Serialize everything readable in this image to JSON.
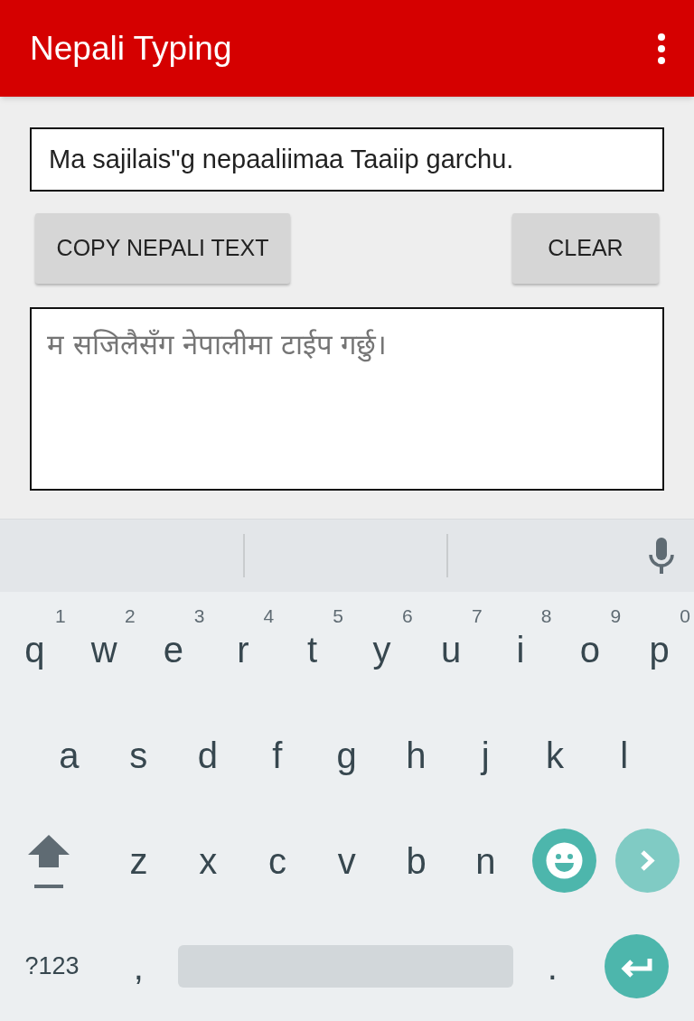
{
  "app_bar": {
    "title": "Nepali Typing"
  },
  "input": {
    "value": "Ma sajilais\"g nepaaliimaa Taaiip garchu."
  },
  "buttons": [
    {
      "label": "COPY NEPALI TEXT"
    },
    {
      "label": "CLEAR"
    }
  ],
  "output": {
    "value": "म सजिलैसँग नेपालीमा टाईप गर्छु।"
  },
  "keyboard": {
    "rows": [
      [
        {
          "kind": "letter",
          "label": "q",
          "hint": "1"
        },
        {
          "kind": "letter",
          "label": "w",
          "hint": "2"
        },
        {
          "kind": "letter",
          "label": "e",
          "hint": "3"
        },
        {
          "kind": "letter",
          "label": "r",
          "hint": "4"
        },
        {
          "kind": "letter",
          "label": "t",
          "hint": "5"
        },
        {
          "kind": "letter",
          "label": "y",
          "hint": "6"
        },
        {
          "kind": "letter",
          "label": "u",
          "hint": "7"
        },
        {
          "kind": "letter",
          "label": "i",
          "hint": "8"
        },
        {
          "kind": "letter",
          "label": "o",
          "hint": "9"
        },
        {
          "kind": "letter",
          "label": "p",
          "hint": "0"
        }
      ],
      [
        {
          "kind": "letter",
          "label": "a"
        },
        {
          "kind": "letter",
          "label": "s"
        },
        {
          "kind": "letter",
          "label": "d"
        },
        {
          "kind": "letter",
          "label": "f"
        },
        {
          "kind": "letter",
          "label": "g"
        },
        {
          "kind": "letter",
          "label": "h"
        },
        {
          "kind": "letter",
          "label": "j"
        },
        {
          "kind": "letter",
          "label": "k"
        },
        {
          "kind": "letter",
          "label": "l"
        }
      ],
      [
        {
          "kind": "shift"
        },
        {
          "kind": "letter",
          "label": "z"
        },
        {
          "kind": "letter",
          "label": "x"
        },
        {
          "kind": "letter",
          "label": "c"
        },
        {
          "kind": "letter",
          "label": "v"
        },
        {
          "kind": "letter",
          "label": "b"
        },
        {
          "kind": "letter",
          "label": "n"
        },
        {
          "kind": "emoji"
        },
        {
          "kind": "next"
        }
      ],
      [
        {
          "kind": "symbols",
          "label": "?123"
        },
        {
          "kind": "letter",
          "label": ","
        },
        {
          "kind": "space"
        },
        {
          "kind": "letter",
          "label": "."
        },
        {
          "kind": "enter"
        }
      ]
    ]
  }
}
